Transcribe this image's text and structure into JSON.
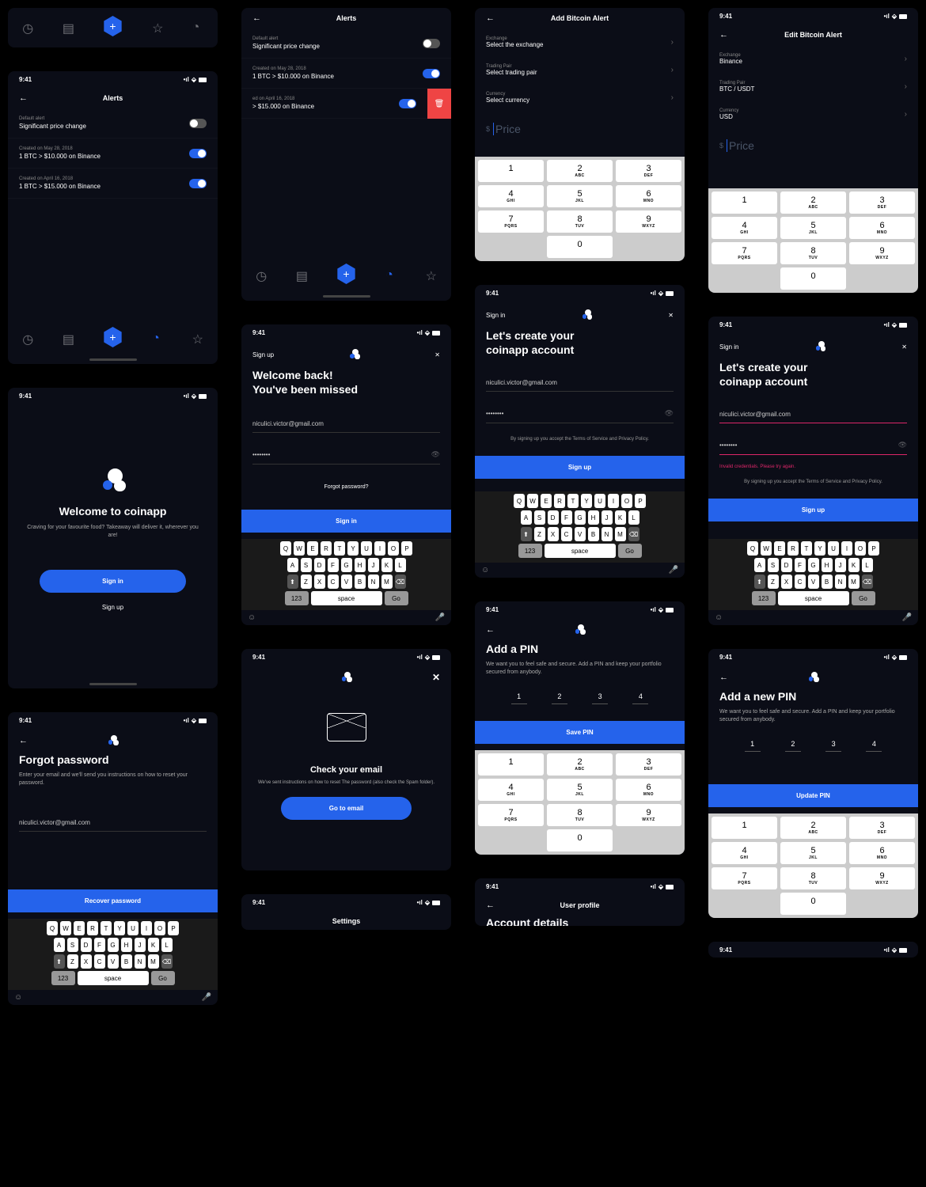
{
  "time": "9:41",
  "screens": {
    "alerts": {
      "title": "Alerts",
      "items": [
        {
          "sub": "Default alert",
          "main": "Significant price change",
          "on": false
        },
        {
          "sub": "Created on May 28, 2018",
          "main": "1 BTC > $10.000 on Binance",
          "on": true
        },
        {
          "sub": "Created on April 16, 2018",
          "main": "1 BTC > $15.000 on Binance",
          "on": true
        }
      ]
    },
    "alerts_swipe": {
      "title": "Alerts",
      "items": [
        {
          "sub": "Default alert",
          "main": "Significant price change",
          "on": false
        },
        {
          "sub": "Created on May 28, 2018",
          "main": "1 BTC > $10.000 on Binance",
          "on": true
        },
        {
          "sub": "ed on April 16, 2018",
          "main": "> $15.000 on Binance",
          "on": true
        }
      ]
    },
    "add_alert": {
      "title": "Add Bitcoin Alert",
      "rows": [
        {
          "label": "Exchange",
          "value": "Select the exchange"
        },
        {
          "label": "Trading Pair",
          "value": "Select trading pair"
        },
        {
          "label": "Currency",
          "value": "Select currency"
        }
      ],
      "price_placeholder": "Price"
    },
    "edit_alert": {
      "title": "Edit Bitcoin Alert",
      "rows": [
        {
          "label": "Exchange",
          "value": "Binance"
        },
        {
          "label": "Trading Pair",
          "value": "BTC / USDT"
        },
        {
          "label": "Currency",
          "value": "USD"
        }
      ],
      "price_placeholder": "Price"
    },
    "welcome": {
      "title": "Welcome to coinapp",
      "sub": "Craving for your favourite food? Takeaway will deliver it, wherever you are!",
      "signin": "Sign in",
      "signup": "Sign up"
    },
    "signin": {
      "header": "Sign up",
      "h1": "Welcome back!",
      "h2": "You've been missed",
      "email": "niculici.victor@gmail.com",
      "pwd": "••••••••",
      "forgot": "Forgot password?",
      "btn": "Sign in"
    },
    "signup": {
      "header": "Sign in",
      "h1": "Let's create your",
      "h2": "coinapp account",
      "email": "niculici.victor@gmail.com",
      "pwd": "••••••••",
      "terms": "By signing up you accept the Terms of Service and Privacy Policy.",
      "btn": "Sign up"
    },
    "signup_err": {
      "header": "Sign in",
      "h1": "Let's create your",
      "h2": "coinapp account",
      "email": "niculici.victor@gmail.com",
      "pwd": "••••••••",
      "error": "Invalid credentials. Please try again.",
      "terms": "By signing up you accept the Terms of Service and Privacy Policy.",
      "btn": "Sign up"
    },
    "forgot": {
      "title": "Forgot password",
      "sub": "Enter your email and we'll send you instructions on how to reset your password.",
      "email": "niculici.victor@gmail.com",
      "btn": "Recover password"
    },
    "check_email": {
      "title": "Check your email",
      "sub": "We've sent instructions on how to reset The password (also check the Spam folder).",
      "btn": "Go to email"
    },
    "add_pin": {
      "title": "Add a PIN",
      "sub": "We want you to feel safe and secure. Add a PIN and keep your portfolio secured from anybody.",
      "digits": [
        "1",
        "2",
        "3",
        "4"
      ],
      "btn": "Save PIN"
    },
    "new_pin": {
      "title": "Add a new PIN",
      "sub": "We want you to feel safe and secure. Add a PIN and keep your portfolio secured from anybody.",
      "digits": [
        "1",
        "2",
        "3",
        "4"
      ],
      "btn": "Update PIN"
    },
    "settings": {
      "title": "Settings"
    },
    "profile": {
      "title": "User profile",
      "h": "Account details"
    }
  },
  "numpad": [
    {
      "d": "1",
      "l": ""
    },
    {
      "d": "2",
      "l": "ABC"
    },
    {
      "d": "3",
      "l": "DEF"
    },
    {
      "d": "4",
      "l": "GHI"
    },
    {
      "d": "5",
      "l": "JKL"
    },
    {
      "d": "6",
      "l": "MNO"
    },
    {
      "d": "7",
      "l": "PQRS"
    },
    {
      "d": "8",
      "l": "TUV"
    },
    {
      "d": "9",
      "l": "WXYZ"
    },
    {
      "d": "0",
      "l": ""
    }
  ],
  "kbd": {
    "r1": [
      "Q",
      "W",
      "E",
      "R",
      "T",
      "Y",
      "U",
      "I",
      "O",
      "P"
    ],
    "r2": [
      "A",
      "S",
      "D",
      "F",
      "G",
      "H",
      "J",
      "K",
      "L"
    ],
    "r3": [
      "Z",
      "X",
      "C",
      "V",
      "B",
      "N",
      "M"
    ],
    "num": "123",
    "space": "space",
    "go": "Go"
  }
}
